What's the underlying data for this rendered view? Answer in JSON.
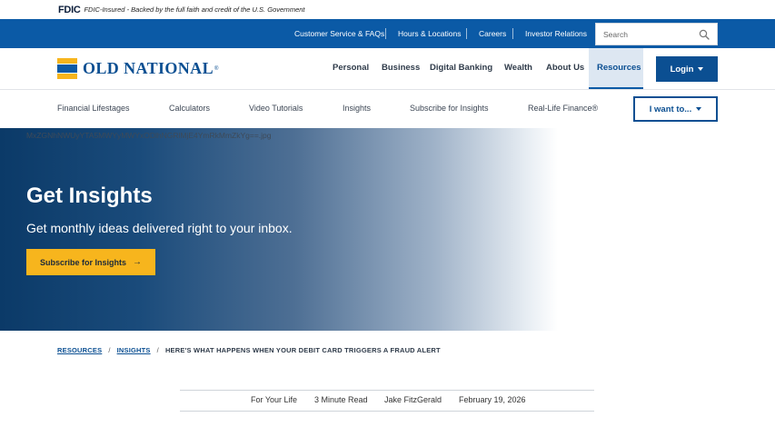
{
  "fdic": {
    "logo": "FDIC",
    "text": "FDIC-Insured - Backed by the full faith and credit of the U.S. Government"
  },
  "utility_nav": {
    "links": [
      "Customer Service & FAQs",
      "Hours & Locations",
      "Careers",
      "Investor Relations"
    ],
    "search_placeholder": "Search"
  },
  "brand": {
    "name": "OLD NATIONAL",
    "registered": "®"
  },
  "main_nav": {
    "items": [
      "Personal",
      "Business",
      "Digital Banking",
      "Wealth",
      "About Us",
      "Resources"
    ],
    "login": "Login"
  },
  "sub_nav": {
    "items": [
      "Financial Lifestages",
      "Calculators",
      "Video Tutorials",
      "Insights",
      "Subscribe for Insights",
      "Real-Life Finance®"
    ],
    "i_want_to": "I want to..."
  },
  "hero": {
    "broken_image_text": "MxZGNhNWUyYTA5MWYyMWYxODlhNGRlMjE4YmRkMmZkYg==.jpg",
    "title": "Get Insights",
    "subtitle": "Get monthly ideas delivered right to your inbox.",
    "cta": "Subscribe for Insights",
    "cta_arrow": "→"
  },
  "breadcrumb": {
    "items": [
      "RESOURCES",
      "INSIGHTS"
    ],
    "separator": "/",
    "current": "HERE'S WHAT HAPPENS WHEN YOUR DEBIT CARD TRIGGERS A FRAUD ALERT"
  },
  "article_meta": {
    "category": "For Your Life",
    "read_time": "3 Minute Read",
    "author": "Jake FitzGerald",
    "date": "February 19, 2026"
  },
  "colors": {
    "brand_blue": "#0b4f92",
    "utility_blue": "#0b5aa6",
    "brand_gold": "#f7b51d",
    "hero_dark": "#0b3a68"
  }
}
